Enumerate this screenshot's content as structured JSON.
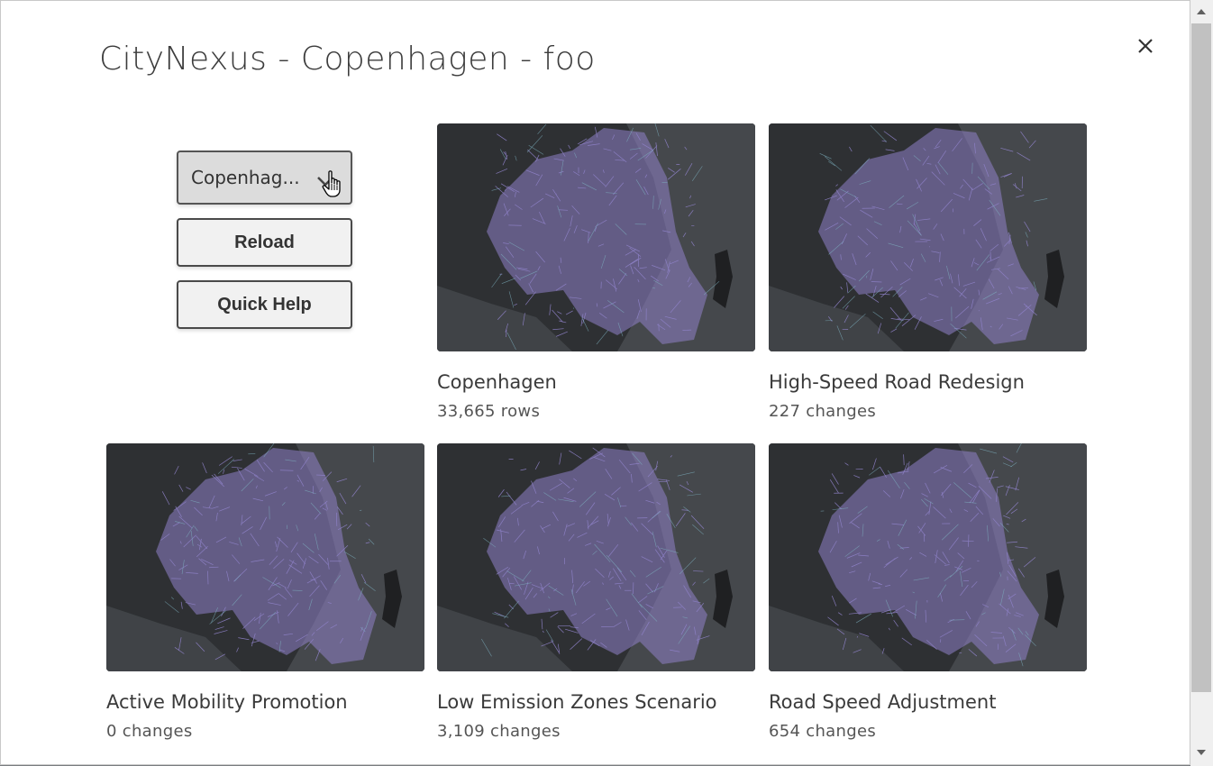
{
  "dialog": {
    "title": "CityNexus - Copenhagen - foo",
    "close_icon": "close-icon"
  },
  "controls": {
    "city_select_value": "Copenhag...",
    "reload_label": "Reload",
    "help_label": "Quick Help"
  },
  "cards": [
    {
      "title": "Copenhagen",
      "sub": "33,665 rows"
    },
    {
      "title": "High-Speed Road Redesign",
      "sub": "227 changes"
    },
    {
      "title": "Active Mobility Promotion",
      "sub": "0 changes"
    },
    {
      "title": "Low Emission Zones Scenario",
      "sub": "3,109 changes"
    },
    {
      "title": "Road Speed Adjustment",
      "sub": "654 changes"
    }
  ],
  "colors": {
    "map_land": "#2e3033",
    "map_water": "#45484c",
    "network": "#8f82c8",
    "network_edge": "#7fb3c2"
  }
}
